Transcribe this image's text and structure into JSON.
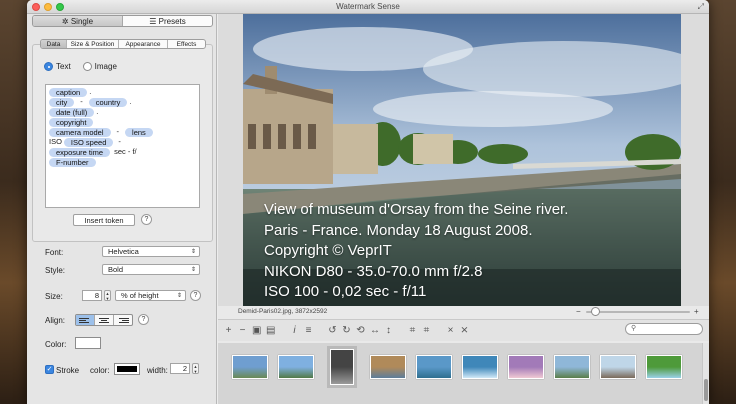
{
  "window": {
    "title": "Watermark Sense",
    "fullscreen_icon": "fullscreen-icon"
  },
  "mode_tabs": [
    {
      "label": "Single",
      "icon": "gear-icon",
      "active": true
    },
    {
      "label": "Presets",
      "icon": "list-icon",
      "active": false
    }
  ],
  "tabs": [
    {
      "label": "Data",
      "active": true
    },
    {
      "label": "Size & Position",
      "active": false
    },
    {
      "label": "Appearance",
      "active": false
    },
    {
      "label": "Effects",
      "active": false
    }
  ],
  "source": {
    "text_label": "Text",
    "image_label": "Image",
    "selected": "Text"
  },
  "tokens": {
    "lines": [
      {
        "t1": "caption",
        "s1": "."
      },
      {
        "t1": "city",
        "s1": "-",
        "t2": "country",
        "s2": "."
      },
      {
        "t1": "date (full)",
        "s1": "."
      },
      {
        "t1": "copyright"
      },
      {
        "t1": "camera model",
        "s1": "-",
        "t2": "lens"
      },
      {
        "p": "ISO",
        "t1": "ISO speed",
        "s1": "-"
      },
      {
        "t1": "exposure time",
        "s1": "sec - f/"
      },
      {
        "t1": "F-number"
      }
    ]
  },
  "insert_token_label": "Insert token",
  "help_glyph": "?",
  "font": {
    "label": "Font:",
    "value": "Helvetica"
  },
  "style": {
    "label": "Style:",
    "value": "Bold"
  },
  "size": {
    "label": "Size:",
    "value": "8",
    "unit": "% of height"
  },
  "align": {
    "label": "Align:",
    "selected": "left"
  },
  "color": {
    "label": "Color:",
    "value": "#ffffff"
  },
  "stroke": {
    "label": "Stroke",
    "checked": true,
    "color_label": "color:",
    "color_value": "#000000",
    "width_label": "width:",
    "width_value": "2"
  },
  "preview": {
    "watermark_lines": [
      "View of museum d'Orsay from the Seine river.",
      "Paris - France.  Monday 18 August 2008.",
      "Copyright © VeprIT",
      "NIKON D80 - 35.0-70.0 mm f/2.8",
      "ISO 100 - 0,02 sec - f/11"
    ],
    "file_info": "Demid-Paris02.jpg,  3872x2592",
    "zoom_level": 0.05,
    "zoom_minus": "−",
    "zoom_plus": "+"
  },
  "toolbar_icons": [
    "add-icon",
    "remove-icon",
    "save-icon",
    "save-all-icon",
    "info-icon",
    "list-icon",
    "rotate-left-icon",
    "rotate-right-icon",
    "rotate-back-icon",
    "flip-horizontal-icon",
    "flip-vertical-icon",
    "crop-icon",
    "crop-all-icon",
    "delete-icon",
    "delete-all-icon"
  ],
  "thumbnails": [
    {
      "colors": [
        "#6f9ed0",
        "#6a8a55"
      ]
    },
    {
      "colors": [
        "#7fb0e0",
        "#527a47"
      ]
    },
    {
      "colors": [
        "#444444",
        "#9a9a9a"
      ]
    },
    {
      "colors": [
        "#b08a5a",
        "#5d7d9a"
      ]
    },
    {
      "colors": [
        "#5a98c8",
        "#2f6f8f"
      ]
    },
    {
      "colors": [
        "#3f87b9",
        "#d0e8f7"
      ]
    },
    {
      "colors": [
        "#a27ab8",
        "#f0c9d3"
      ]
    },
    {
      "colors": [
        "#8fb7d8",
        "#5a7e4a"
      ]
    },
    {
      "colors": [
        "#bfd6e8",
        "#7a6a5a"
      ]
    },
    {
      "colors": [
        "#4e9a3a",
        "#9ad0e8"
      ]
    }
  ]
}
